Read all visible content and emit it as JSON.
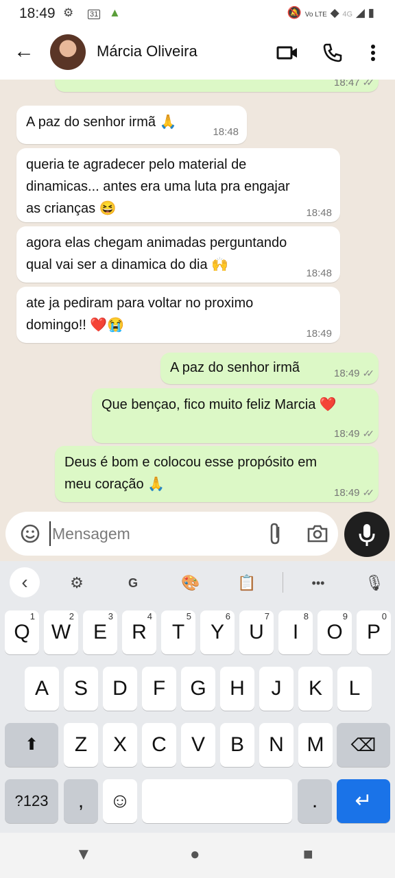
{
  "status_bar": {
    "time": "18:49",
    "left_icons": [
      "settings-icon",
      "calendar-icon",
      "android-icon"
    ],
    "right_icons": [
      "mute-icon",
      "volte-icon",
      "wifi-icon",
      "signal-icon",
      "battery-icon"
    ],
    "calendar_day": "31",
    "volte": "Vo LTE",
    "net": "4G"
  },
  "header": {
    "contact_name": "Márcia Oliveira"
  },
  "messages": [
    {
      "dir": "out",
      "text": "",
      "time": "18:47"
    },
    {
      "dir": "in",
      "text": "A paz do senhor irmã 🙏",
      "time": "18:48"
    },
    {
      "dir": "in",
      "text": "queria te agradecer pelo material de\ndinamicas... antes era uma luta pra engajar\nas crianças 😆",
      "time": "18:48"
    },
    {
      "dir": "in",
      "text": "agora elas chegam animadas perguntando\nqual vai ser a dinamica do dia 🙌",
      "time": "18:48"
    },
    {
      "dir": "in",
      "text": "ate ja pediram para voltar no proximo\ndomingo!! ❤️😭",
      "time": "18:49"
    },
    {
      "dir": "out",
      "text": "A paz do senhor irmã",
      "time": "18:49"
    },
    {
      "dir": "out",
      "text": "Que bençao, fico muito feliz Marcia ❤️",
      "time": "18:49"
    },
    {
      "dir": "out",
      "text": "Deus é bom e colocou esse  propósito em\nmeu coração 🙏",
      "time": "18:49"
    }
  ],
  "input": {
    "placeholder": "Mensagem"
  },
  "keyboard": {
    "row1": [
      {
        "k": "Q",
        "n": "1"
      },
      {
        "k": "W",
        "n": "2"
      },
      {
        "k": "E",
        "n": "3"
      },
      {
        "k": "R",
        "n": "4"
      },
      {
        "k": "T",
        "n": "5"
      },
      {
        "k": "Y",
        "n": "6"
      },
      {
        "k": "U",
        "n": "7"
      },
      {
        "k": "I",
        "n": "8"
      },
      {
        "k": "O",
        "n": "9"
      },
      {
        "k": "P",
        "n": "0"
      }
    ],
    "row2": [
      "A",
      "S",
      "D",
      "F",
      "G",
      "H",
      "J",
      "K",
      "L"
    ],
    "row3": [
      "Z",
      "X",
      "C",
      "V",
      "B",
      "N",
      "M"
    ],
    "symbols_label": "?123",
    "comma": ",",
    "period": ".",
    "enter": "↵",
    "emoji": "☺",
    "shift": "⬆",
    "backspace": "⌫",
    "tools": {
      "back": "‹",
      "settings": "⚙",
      "translate": "G",
      "palette": "🎨",
      "clipboard": "📋",
      "more": "•••",
      "voice": "🎙"
    }
  },
  "nav": {
    "back": "▼",
    "home": "●",
    "recents": "■"
  }
}
